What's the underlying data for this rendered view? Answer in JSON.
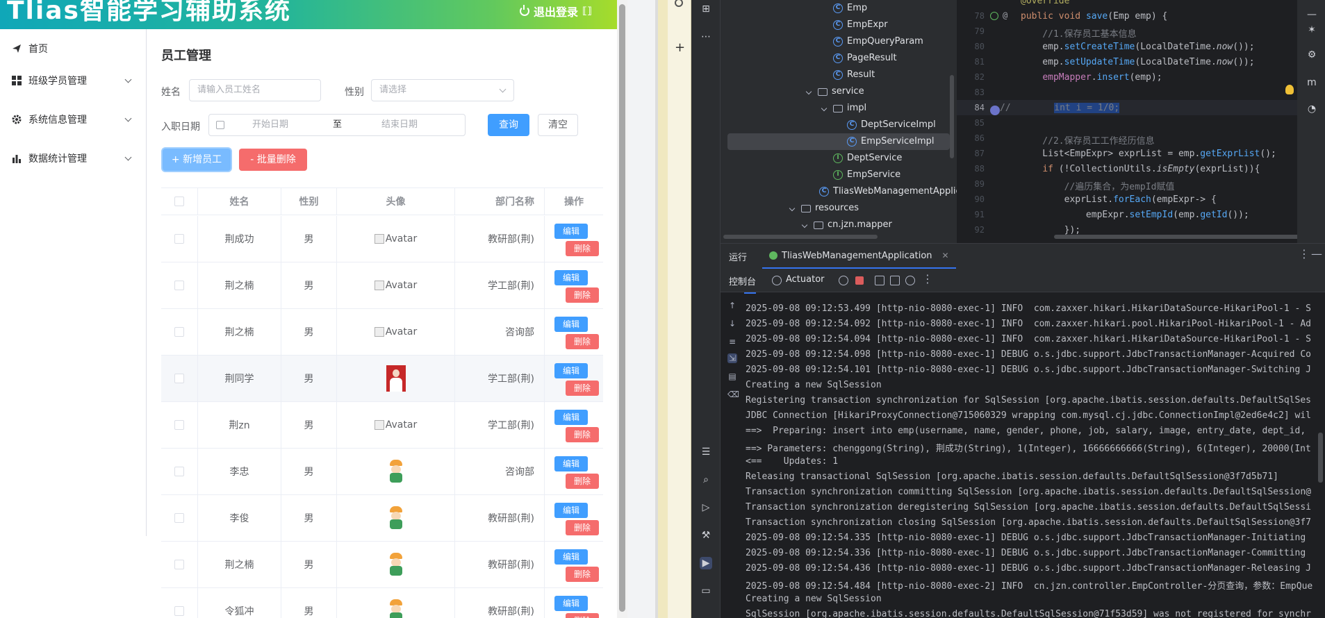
{
  "web": {
    "app_title": "Tlias智能学习辅助系统",
    "logout_label": "退出登录",
    "sidebar": {
      "items": [
        {
          "label": "首页",
          "icon": "send-icon",
          "expandable": false
        },
        {
          "label": "班级学员管理",
          "icon": "grid-icon",
          "expandable": true
        },
        {
          "label": "系统信息管理",
          "icon": "gear-icon",
          "expandable": true
        },
        {
          "label": "数据统计管理",
          "icon": "bar-chart-icon",
          "expandable": true
        }
      ]
    },
    "page_title": "员工管理",
    "filters": {
      "name_label": "姓名",
      "name_placeholder": "请输入员工姓名",
      "gender_label": "性别",
      "gender_placeholder": "请选择",
      "date_label": "入职日期",
      "start_placeholder": "开始日期",
      "range_sep": "至",
      "end_placeholder": "结束日期",
      "query_label": "查询",
      "clear_label": "清空"
    },
    "actions": {
      "add_label": "+ 新增员工",
      "batch_delete_label": "- 批量删除"
    },
    "table": {
      "columns": [
        "姓名",
        "性别",
        "头像",
        "部门名称",
        "操作"
      ],
      "edit_label": "编辑",
      "delete_label": "删除",
      "rows": [
        {
          "name": "荆成功",
          "gender": "男",
          "avatar": "broken",
          "avatar_alt": "Avatar",
          "dept": "教研部(荆)"
        },
        {
          "name": "荆之楠",
          "gender": "男",
          "avatar": "broken",
          "avatar_alt": "Avatar",
          "dept": "学工部(荆)"
        },
        {
          "name": "荆之楠",
          "gender": "男",
          "avatar": "broken",
          "avatar_alt": "Avatar",
          "dept": "咨询部"
        },
        {
          "name": "荆同学",
          "gender": "男",
          "avatar": "photo",
          "avatar_alt": "",
          "dept": "学工部(荆)"
        },
        {
          "name": "荆zn",
          "gender": "男",
          "avatar": "broken",
          "avatar_alt": "Avatar",
          "dept": "学工部(荆)"
        },
        {
          "name": "李忠",
          "gender": "男",
          "avatar": "cartoon",
          "avatar_alt": "",
          "dept": "咨询部"
        },
        {
          "name": "李俊",
          "gender": "男",
          "avatar": "cartoon",
          "avatar_alt": "",
          "dept": "教研部(荆)"
        },
        {
          "name": "荆之楠",
          "gender": "男",
          "avatar": "cartoon",
          "avatar_alt": "",
          "dept": "教研部(荆)"
        },
        {
          "name": "令狐冲",
          "gender": "男",
          "avatar": "cartoon",
          "avatar_alt": "",
          "dept": "教研部(荆)"
        }
      ]
    }
  },
  "ide": {
    "project_tree": [
      {
        "label": "Emp",
        "kind": "class"
      },
      {
        "label": "EmpExpr",
        "kind": "class"
      },
      {
        "label": "EmpQueryParam",
        "kind": "class"
      },
      {
        "label": "PageResult",
        "kind": "class"
      },
      {
        "label": "Result",
        "kind": "class"
      },
      {
        "label": "service",
        "kind": "folder"
      },
      {
        "label": "impl",
        "kind": "folder"
      },
      {
        "label": "DeptServiceImpl",
        "kind": "class"
      },
      {
        "label": "EmpServiceImpl",
        "kind": "class"
      },
      {
        "label": "DeptService",
        "kind": "interface"
      },
      {
        "label": "EmpService",
        "kind": "interface"
      },
      {
        "label": "TliasWebManagementApplic",
        "kind": "class"
      },
      {
        "label": "resources",
        "kind": "folder"
      },
      {
        "label": "cn.jzn.mapper",
        "kind": "folder"
      }
    ],
    "editor": {
      "line_numbers": [
        "78",
        "79",
        "80",
        "81",
        "82",
        "83",
        "84",
        "85",
        "86",
        "87",
        "88",
        "89",
        "90",
        "91",
        "92"
      ],
      "top_partial": "@Override",
      "lines": [
        "public void save(Emp emp) {",
        "    //1.保存员工基本信息",
        "    emp.setCreateTime(LocalDateTime.now());",
        "    emp.setUpdateTime(LocalDateTime.now());",
        "    empMapper.insert(emp);",
        "",
        "//        int i = 1/0;",
        "",
        "    //2.保存员工工作经历信息",
        "    List<EmpExpr> exprList = emp.getExprList();",
        "    if (!CollectionUtils.isEmpty(exprList)){",
        "        //遍历集合，为empId赋值",
        "        exprList.forEach(empExpr-> {",
        "            empExpr.setEmpId(emp.getId());",
        "        });"
      ]
    },
    "run": {
      "panel_label": "运行",
      "tab_label": "TliasWebManagementApplication",
      "console_label": "控制台",
      "actuator_label": "Actuator",
      "console_lines": [
        "2025-09-08 09:12:53.499 [http-nio-8080-exec-1] INFO  com.zaxxer.hikari.HikariDataSource-HikariPool-1 - S",
        "2025-09-08 09:12:54.092 [http-nio-8080-exec-1] INFO  com.zaxxer.hikari.pool.HikariPool-HikariPool-1 - Ad",
        "2025-09-08 09:12:54.094 [http-nio-8080-exec-1] INFO  com.zaxxer.hikari.HikariDataSource-HikariPool-1 - S",
        "2025-09-08 09:12:54.098 [http-nio-8080-exec-1] DEBUG o.s.jdbc.support.JdbcTransactionManager-Acquired Co",
        "2025-09-08 09:12:54.101 [http-nio-8080-exec-1] DEBUG o.s.jdbc.support.JdbcTransactionManager-Switching J",
        "Creating a new SqlSession",
        "Registering transaction synchronization for SqlSession [org.apache.ibatis.session.defaults.DefaultSqlSes",
        "JDBC Connection [HikariProxyConnection@715060329 wrapping com.mysql.cj.jdbc.ConnectionImpl@2ed6e4c2] wil",
        "==>  Preparing: insert into emp(username, name, gender, phone, job, salary, image, entry_date, dept_id,",
        "==> Parameters: chenggong(String), 荆成功(String), 1(Integer), 16666666666(String), 6(Integer), 20000(Int",
        "<==    Updates: 1",
        "Releasing transactional SqlSession [org.apache.ibatis.session.defaults.DefaultSqlSession@3f7d5b71]",
        "Transaction synchronization committing SqlSession [org.apache.ibatis.session.defaults.DefaultSqlSession@",
        "Transaction synchronization deregistering SqlSession [org.apache.ibatis.session.defaults.DefaultSqlSessi",
        "Transaction synchronization closing SqlSession [org.apache.ibatis.session.defaults.DefaultSqlSession@3f7",
        "2025-09-08 09:12:54.335 [http-nio-8080-exec-1] DEBUG o.s.jdbc.support.JdbcTransactionManager-Initiating",
        "2025-09-08 09:12:54.336 [http-nio-8080-exec-1] DEBUG o.s.jdbc.support.JdbcTransactionManager-Committing",
        "2025-09-08 09:12:54.436 [http-nio-8080-exec-1] DEBUG o.s.jdbc.support.JdbcTransactionManager-Releasing J",
        "2025-09-08 09:12:54.484 [http-nio-8080-exec-2] INFO  cn.jzn.controller.EmpController-分页查询，参数：EmpQue",
        "Creating a new SqlSession",
        "SqlSession [org.apache.ibatis.session.defaults.DefaultSqlSession@71f53d59] was not registered for synchr"
      ]
    },
    "colors": {
      "selection": "#214283",
      "keyword": "#cf8e6d",
      "comment": "#7a7e85",
      "method": "#56a8f5",
      "field": "#c77dbb",
      "accent": "#3574f0"
    }
  }
}
